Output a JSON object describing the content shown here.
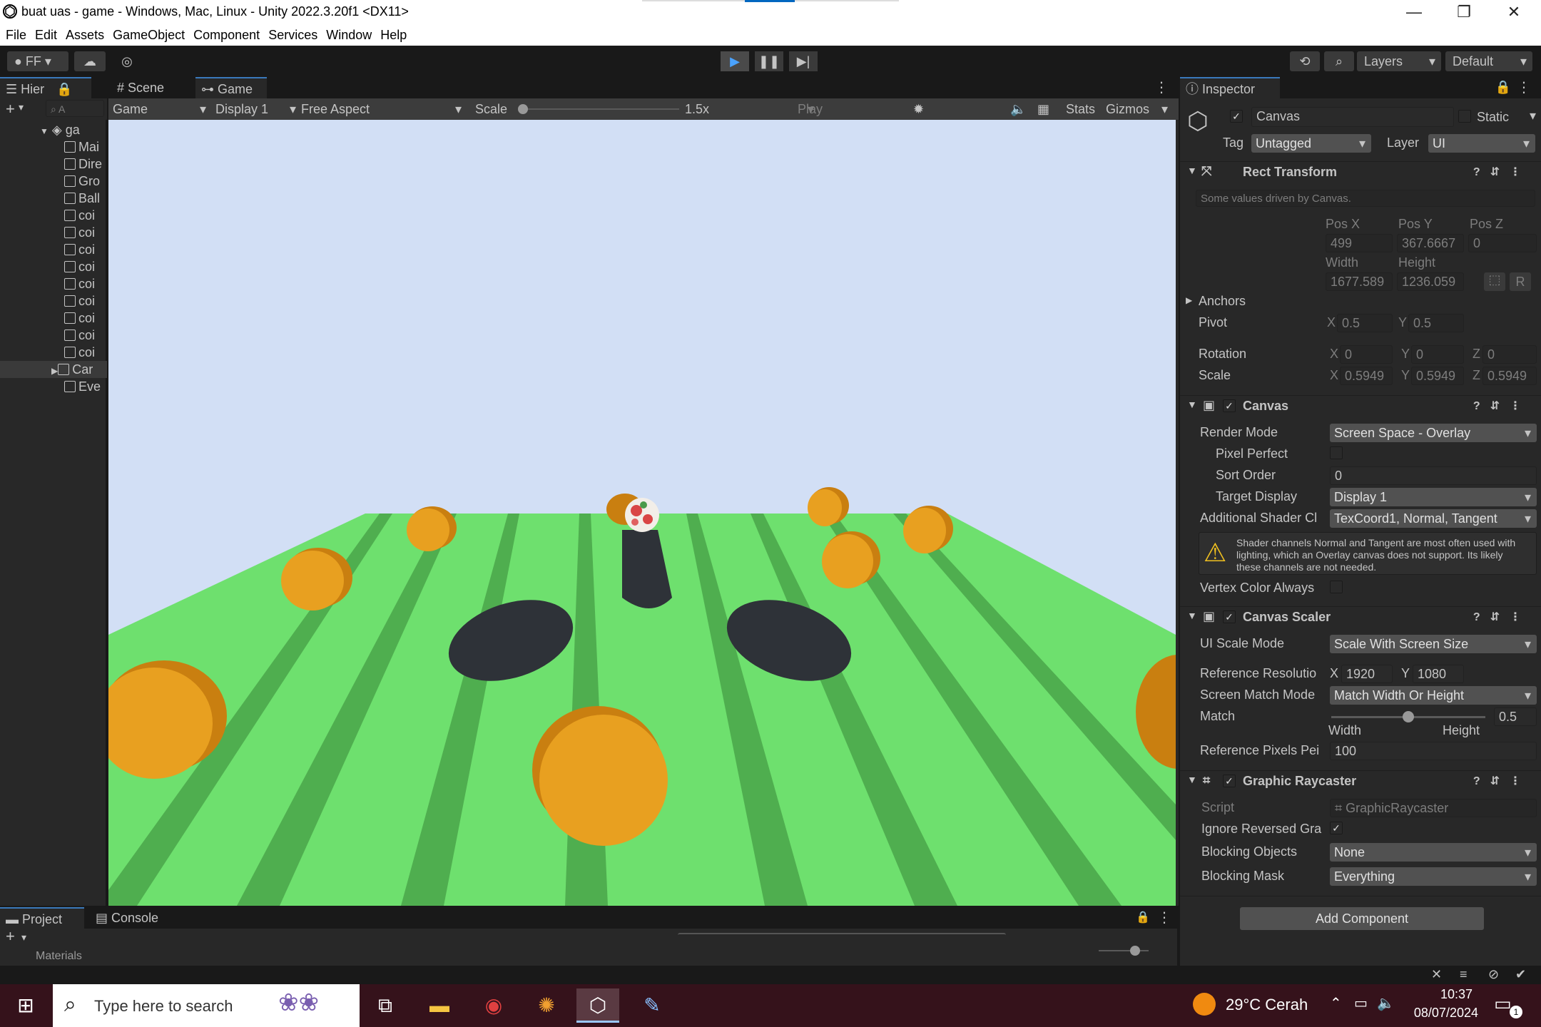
{
  "window": {
    "title": "buat uas - game - Windows, Mac, Linux - Unity 2022.3.20f1 <DX11>",
    "minimize": "—",
    "restore": "❐",
    "close": "✕"
  },
  "menu": [
    "File",
    "Edit",
    "Assets",
    "GameObject",
    "Component",
    "Services",
    "Window",
    "Help"
  ],
  "toolbar": {
    "account": "FF",
    "layers_label": "Layers",
    "layout_label": "Default",
    "play_icon": "play-icon",
    "pause_icon": "pause-icon",
    "step_icon": "step-icon"
  },
  "hierarchy": {
    "tab": "Hier",
    "search_placeholder": "A",
    "root": "ga",
    "items": [
      "Mai",
      "Dire",
      "Gro",
      "Ball",
      "coi",
      "coi",
      "coi",
      "coi",
      "coi",
      "coi",
      "coi",
      "coi",
      "coi",
      "Car",
      "Eve"
    ]
  },
  "center_tabs": {
    "scene": "Scene",
    "game": "Game"
  },
  "game_controls": {
    "game_select": "Game",
    "display": "Display 1",
    "aspect": "Free Aspect",
    "scale_label": "Scale",
    "scale_value": "1.5x",
    "play_focused": "Play Focused",
    "stats": "Stats",
    "gizmos": "Gizmos"
  },
  "inspector": {
    "tab": "Inspector",
    "object_name": "Canvas",
    "static_label": "Static",
    "tag_label": "Tag",
    "tag_value": "Untagged",
    "layer_label": "Layer",
    "layer_value": "UI",
    "rect_transform": {
      "title": "Rect Transform",
      "note": "Some values driven by Canvas.",
      "pos_x_label": "Pos X",
      "pos_y_label": "Pos Y",
      "pos_z_label": "Pos Z",
      "pos_x": "499",
      "pos_y": "367.6667",
      "pos_z": "0",
      "width_label": "Width",
      "height_label": "Height",
      "width": "1677.589",
      "height": "1236.059",
      "r_button": "R",
      "anchors": "Anchors",
      "pivot": "Pivot",
      "pivot_x": "0.5",
      "pivot_y": "0.5",
      "rotation": "Rotation",
      "rot_x": "0",
      "rot_y": "0",
      "rot_z": "0",
      "scale": "Scale",
      "scale_x": "0.5949",
      "scale_y": "0.5949",
      "scale_z": "0.5949",
      "x": "X",
      "y": "Y",
      "z": "Z"
    },
    "canvas": {
      "title": "Canvas",
      "render_mode_label": "Render Mode",
      "render_mode": "Screen Space - Overlay",
      "pixel_perfect": "Pixel Perfect",
      "sort_order_label": "Sort Order",
      "sort_order": "0",
      "target_display_label": "Target Display",
      "target_display": "Display 1",
      "shader_label": "Additional Shader Cl",
      "shader_value": "TexCoord1, Normal, Tangent",
      "warning": "Shader channels Normal and Tangent are most often used with lighting, which an Overlay canvas does not support. Its likely these channels are not needed.",
      "vertex_color": "Vertex Color Always"
    },
    "canvas_scaler": {
      "title": "Canvas Scaler",
      "ui_scale_label": "UI Scale Mode",
      "ui_scale": "Scale With Screen Size",
      "ref_res_label": "Reference Resolutio",
      "ref_x": "1920",
      "ref_y": "1080",
      "match_mode_label": "Screen Match Mode",
      "match_mode": "Match Width Or Height",
      "match_label": "Match",
      "match_value": "0.5",
      "match_fraction": 0.5,
      "width_label": "Width",
      "height_label": "Height",
      "ppu_label": "Reference Pixels Pei",
      "ppu": "100"
    },
    "graphic_raycaster": {
      "title": "Graphic Raycaster",
      "script_label": "Script",
      "script_value": "GraphicRaycaster",
      "ignore_label": "Ignore Reversed Gra",
      "blocking_objects_label": "Blocking Objects",
      "blocking_objects": "None",
      "blocking_mask_label": "Blocking Mask",
      "blocking_mask": "Everything"
    },
    "add_component": "Add Component"
  },
  "bottom": {
    "project_tab": "Project",
    "console_tab": "Console",
    "folder": "Materials"
  },
  "taskbar": {
    "search_placeholder": "Type here to search",
    "weather": "29°C  Cerah",
    "time": "10:37",
    "date": "08/07/2024",
    "notifications": "1"
  },
  "colors": {
    "sky": "#d2dff5",
    "ground_light": "#6ee06e",
    "ground_dark": "#4fae4f",
    "coin": "#e8a020",
    "coin_dark": "#c97f10",
    "shadow": "#2e3238",
    "taskbar": "#35121b",
    "accent": "#3a79bb"
  }
}
